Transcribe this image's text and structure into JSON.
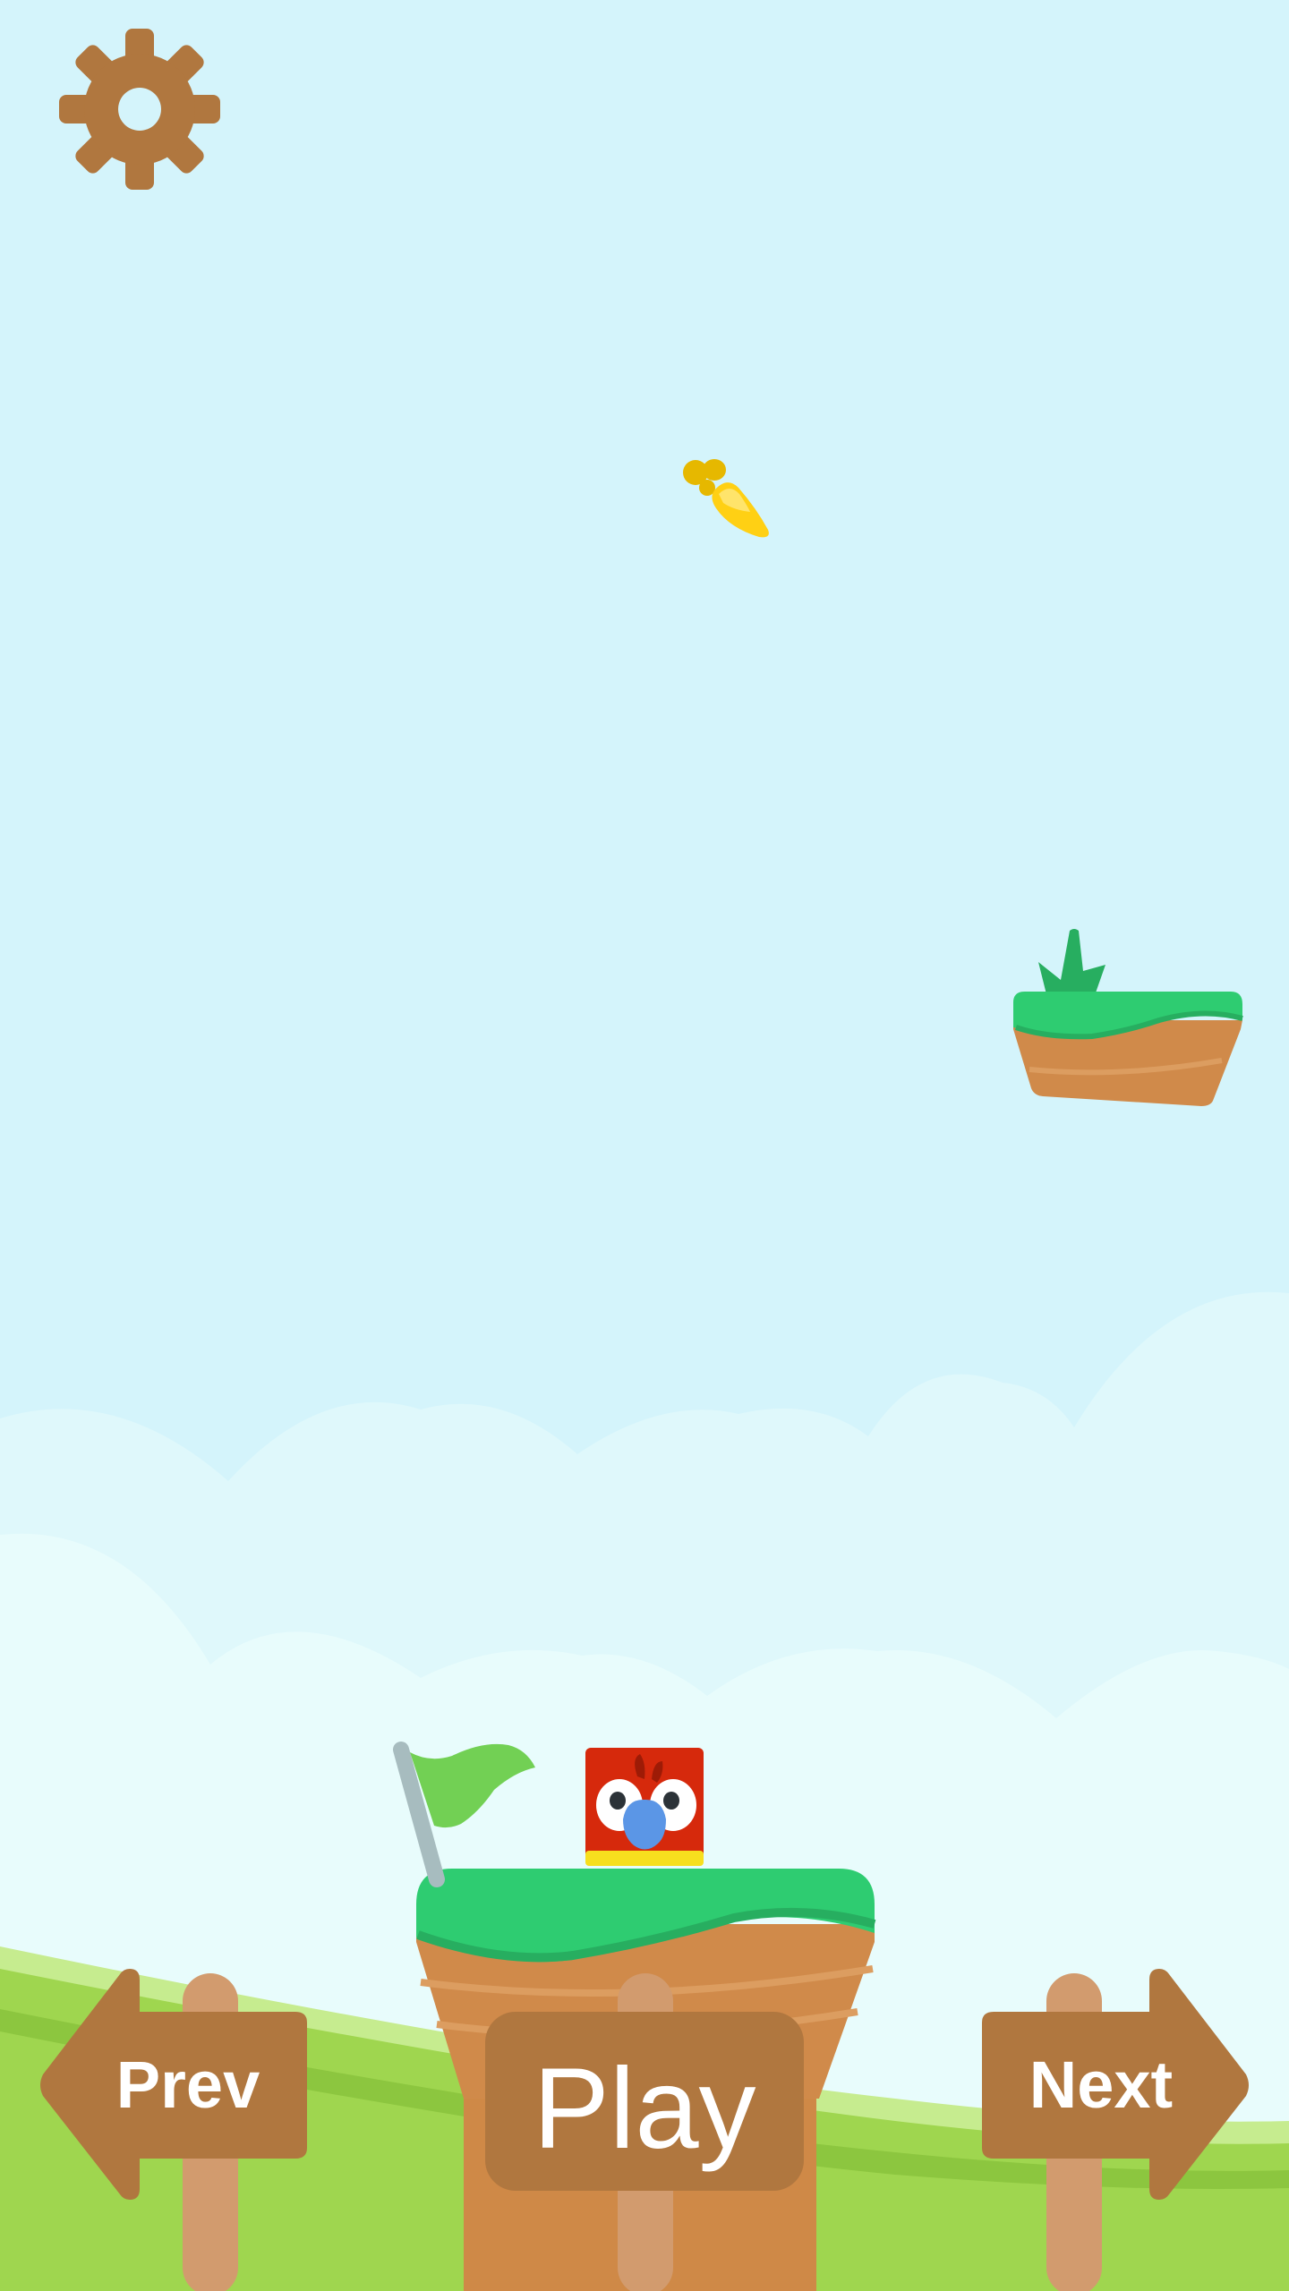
{
  "game": {
    "colors": {
      "sky": "#d4f4fb",
      "cloud_far": "#dff8fb",
      "cloud_near": "#e8fcfc",
      "hill_light": "#c6ec8f",
      "hill": "#9fd64f",
      "hill_dark": "#8cc63f",
      "grass": "#2ecc71",
      "grass_dark": "#27ae60",
      "dirt": "#d08a4a",
      "dirt_light": "#dc9d60",
      "wood": "#b0773f",
      "post": "#d29b6e",
      "flag": "#72d054",
      "flag_pole": "#a7bcbf",
      "banana": "#ffd014",
      "parrot_red": "#d6290c",
      "parrot_beak": "#5b96e6",
      "parrot_yellow": "#f7df1e"
    },
    "icons": {
      "settings": "gear-icon",
      "prev": "arrow-left-sign",
      "next": "arrow-right-sign",
      "collectible": "banana-icon",
      "player": "parrot-character",
      "goal": "flag-icon"
    },
    "buttons": {
      "prev_label": "Prev",
      "play_label": "Play",
      "next_label": "Next"
    }
  }
}
